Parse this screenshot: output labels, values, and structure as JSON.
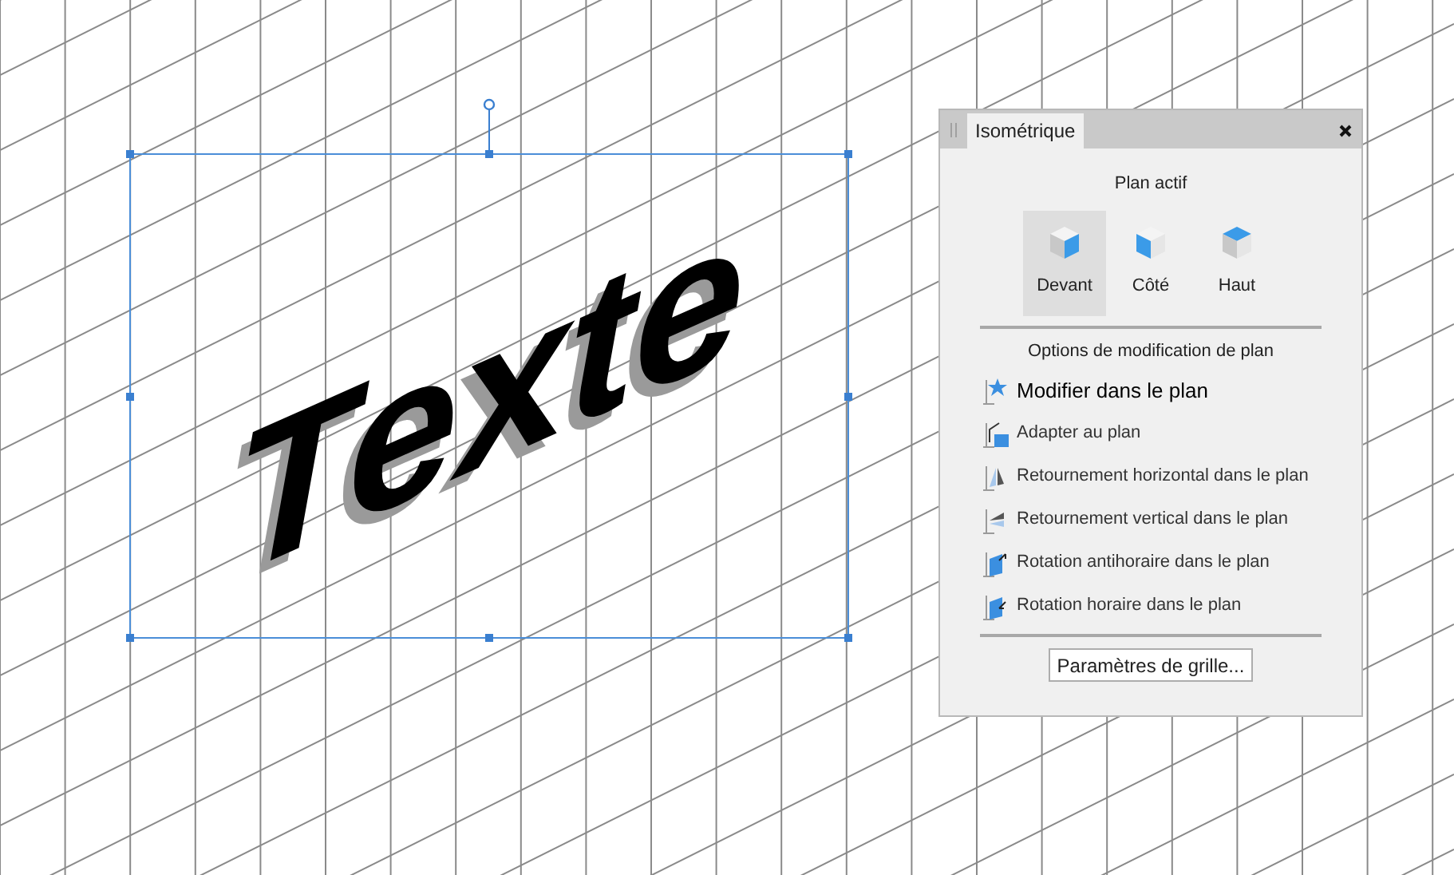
{
  "canvas": {
    "artwork_text": "Texte",
    "selected": true
  },
  "panel": {
    "title": "Isométrique",
    "active_plane": {
      "heading": "Plan actif",
      "planes": [
        {
          "label": "Devant",
          "kind": "front",
          "selected": true
        },
        {
          "label": "Côté",
          "kind": "side",
          "selected": false
        },
        {
          "label": "Haut",
          "kind": "top",
          "selected": false
        }
      ]
    },
    "options": {
      "heading": "Options de modification de plan",
      "items": [
        {
          "label": "Modifier dans le plan",
          "kind": "edit",
          "highlighted": true
        },
        {
          "label": "Adapter au plan",
          "kind": "fit",
          "highlighted": false
        },
        {
          "label": "Retournement horizontal dans le plan",
          "kind": "flip-h",
          "highlighted": false
        },
        {
          "label": "Retournement vertical dans le plan",
          "kind": "flip-v",
          "highlighted": false
        },
        {
          "label": "Rotation antihoraire dans le plan",
          "kind": "rotate-ccw",
          "highlighted": false
        },
        {
          "label": "Rotation horaire dans le plan",
          "kind": "rotate-cw",
          "highlighted": false
        }
      ]
    },
    "grid_button": "Paramètres de grille..."
  }
}
